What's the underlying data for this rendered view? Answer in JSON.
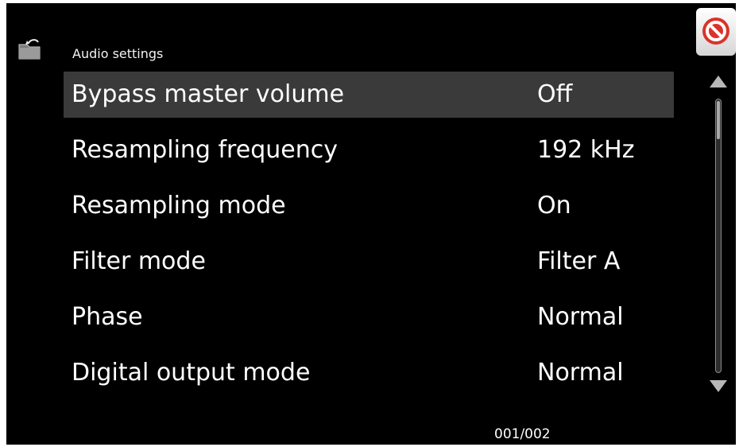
{
  "header": {
    "title": "Audio settings",
    "back_icon": "folder-back-icon",
    "close_icon": "close-icon"
  },
  "settings": [
    {
      "label": "Bypass master volume",
      "value": "Off",
      "selected": true
    },
    {
      "label": "Resampling frequency",
      "value": "192 kHz",
      "selected": false
    },
    {
      "label": "Resampling mode",
      "value": "On",
      "selected": false
    },
    {
      "label": "Filter mode",
      "value": "Filter A",
      "selected": false
    },
    {
      "label": "Phase",
      "value": "Normal",
      "selected": false
    },
    {
      "label": "Digital output mode",
      "value": "Normal",
      "selected": false
    }
  ],
  "pagination": {
    "text": "001/002"
  },
  "colors": {
    "background": "#000000",
    "selected_row": "#3a3a3a",
    "text": "#ffffff",
    "close_accent": "#d9342b"
  }
}
